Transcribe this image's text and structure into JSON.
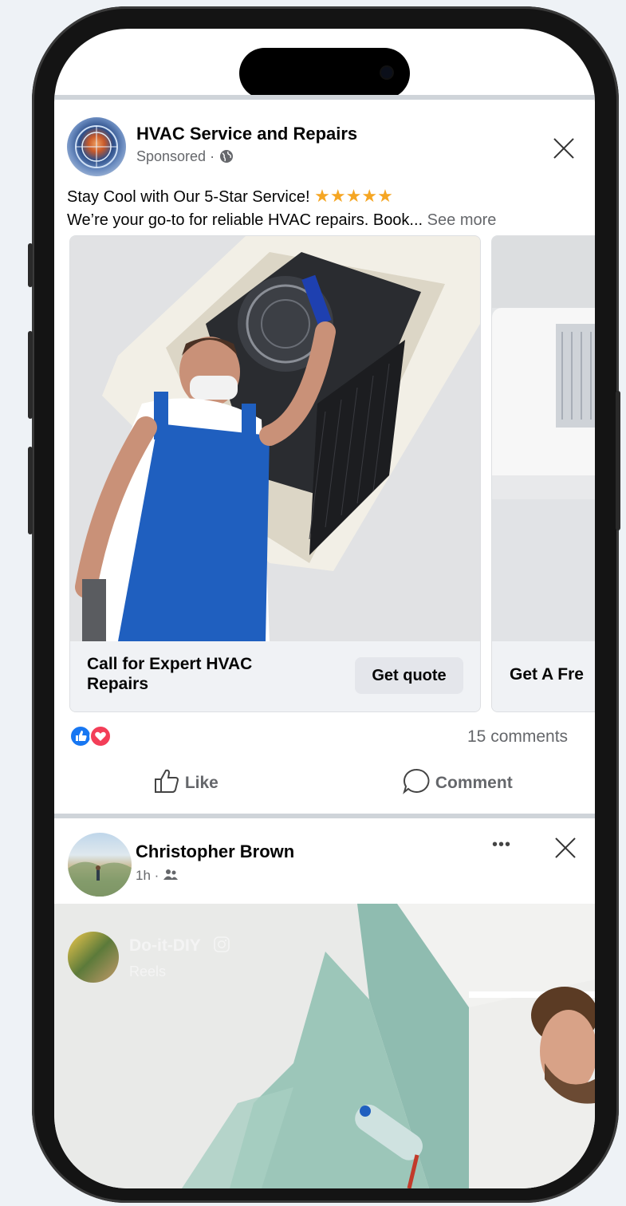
{
  "ad_post": {
    "page_name": "HVAC Service and Repairs",
    "sponsored_label": "Sponsored ·",
    "headline_text": "Stay Cool with Our 5-Star Service!",
    "star_rating": 5,
    "body_text": "We’re your go-to for reliable HVAC repairs. Book...",
    "see_more": "See more",
    "carousel": [
      {
        "caption": "Call for Expert HVAC Repairs",
        "button": "Get quote"
      },
      {
        "caption": "Get A Fre"
      }
    ],
    "comments_count": "15 comments",
    "like_label": "Like",
    "comment_label": "Comment"
  },
  "friend_post": {
    "author": "Christopher Brown",
    "time": "1h ·",
    "more_icon": "•••",
    "reel": {
      "creator": "Do-it-DIY",
      "subtitle": "Reels"
    }
  },
  "colors": {
    "like_blue": "#1877f2",
    "love_red": "#f33e58",
    "overall_blue": "#1f5fbf"
  },
  "icons": [
    "close-icon",
    "globe-icon",
    "star-icon",
    "like-reaction-icon",
    "love-reaction-icon",
    "thumbs-up-icon",
    "comment-bubble-icon",
    "friends-icon",
    "more-icon",
    "instagram-icon"
  ]
}
